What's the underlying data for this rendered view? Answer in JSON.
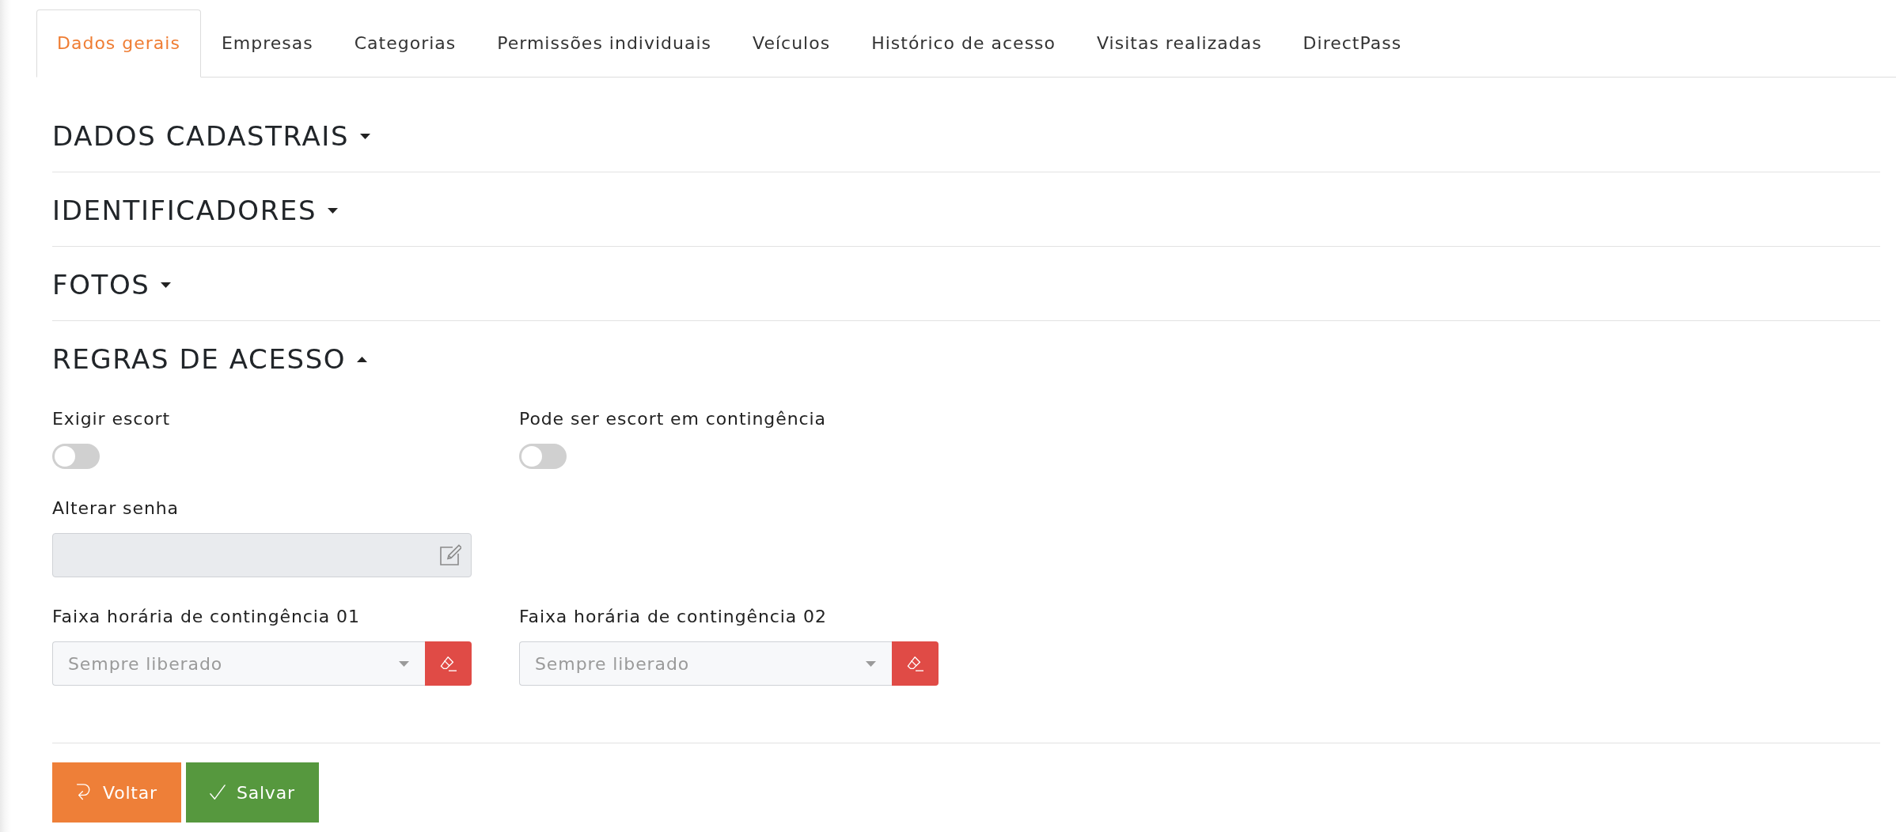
{
  "tabs": [
    {
      "label": "Dados gerais",
      "selected": true
    },
    {
      "label": "Empresas",
      "selected": false
    },
    {
      "label": "Categorias",
      "selected": false
    },
    {
      "label": "Permissões individuais",
      "selected": false
    },
    {
      "label": "Veículos",
      "selected": false
    },
    {
      "label": "Histórico de acesso",
      "selected": false
    },
    {
      "label": "Visitas realizadas",
      "selected": false
    },
    {
      "label": "DirectPass",
      "selected": false
    }
  ],
  "sections": [
    {
      "title": "DADOS CADASTRAIS",
      "expanded": false
    },
    {
      "title": "IDENTIFICADORES",
      "expanded": false
    },
    {
      "title": "FOTOS",
      "expanded": false
    },
    {
      "title": "REGRAS DE ACESSO",
      "expanded": true,
      "rows": [
        [
          {
            "kind": "toggle",
            "label": "Exigir escort",
            "on": false
          },
          {
            "kind": "toggle",
            "label": "Pode ser escort em contingência",
            "on": false
          }
        ],
        [
          {
            "kind": "password",
            "label": "Alterar senha",
            "disabled": true
          }
        ],
        [
          {
            "kind": "select",
            "label": "Faixa horária de contingência 01",
            "placeholder": "Sempre liberado"
          },
          {
            "kind": "select",
            "label": "Faixa horária de contingência 02",
            "placeholder": "Sempre liberado"
          }
        ]
      ]
    }
  ],
  "actions": [
    {
      "kind": "back",
      "label": "Voltar"
    },
    {
      "kind": "save",
      "label": "Salvar"
    }
  ]
}
